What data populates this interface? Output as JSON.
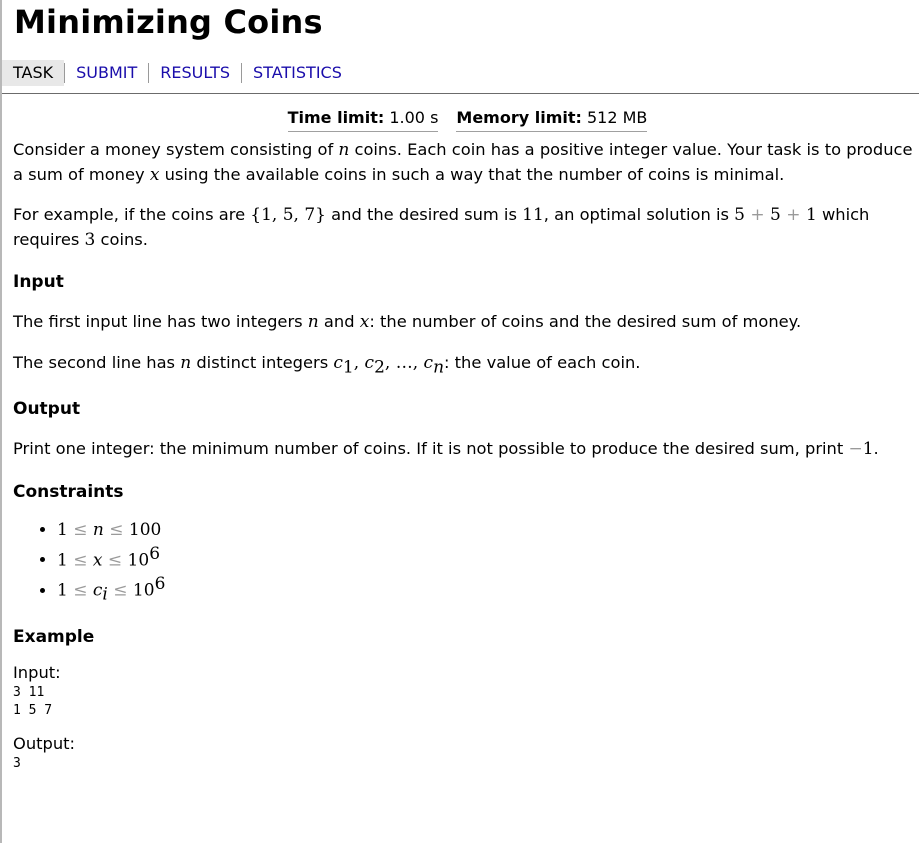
{
  "page_title": "Minimizing Coins",
  "nav": {
    "tabs": [
      {
        "label": "TASK",
        "current": true
      },
      {
        "label": "SUBMIT"
      },
      {
        "label": "RESULTS"
      },
      {
        "label": "STATISTICS"
      }
    ]
  },
  "limits": {
    "time_label": "Time limit:",
    "time_value": "1.00 s",
    "memory_label": "Memory limit:",
    "memory_value": "512 MB"
  },
  "statement": {
    "p1_a": "Consider a money system consisting of ",
    "p1_n": "n",
    "p1_b": " coins. Each coin has a positive integer value. Your task is to produce a sum of money ",
    "p1_x": "x",
    "p1_c": " using the available coins in such a way that the number of coins is minimal.",
    "p2_a": "For example, if the coins are ",
    "p2_set": "{1, 5, 7}",
    "p2_b": " and the desired sum is ",
    "p2_sum": "11",
    "p2_c": ", an optimal solution is ",
    "p2_expr_1": "5",
    "p2_expr_plus1": " + ",
    "p2_expr_2": "5",
    "p2_expr_plus2": " + ",
    "p2_expr_3": "1",
    "p2_d": " which requires ",
    "p2_count": "3",
    "p2_e": " coins."
  },
  "input_section": {
    "heading": "Input",
    "l1_a": "The first input line has two integers ",
    "l1_n": "n",
    "l1_and": " and ",
    "l1_x": "x",
    "l1_b": ": the number of coins and the desired sum of money.",
    "l2_a": "The second line has ",
    "l2_n": "n",
    "l2_b": " distinct integers ",
    "l2_c": "c",
    "l2_s1": "1",
    "l2_c2": "c",
    "l2_s2": "2",
    "l2_dots": "…",
    "l2_cn": "c",
    "l2_sn": "n",
    "l2_tail": ": the value of each coin."
  },
  "output_section": {
    "heading": "Output",
    "text_a": "Print one integer: the minimum number of coins. If it is not possible to produce the desired sum, print ",
    "minus": "−",
    "one": "1",
    "text_end": "."
  },
  "constraints": {
    "heading": "Constraints",
    "items": [
      {
        "low": "1",
        "var": "n",
        "high": "100",
        "exp": ""
      },
      {
        "low": "1",
        "var": "x",
        "high": "10",
        "exp": "6"
      },
      {
        "low": "1",
        "var": "c",
        "sub": "i",
        "high": "10",
        "exp": "6"
      }
    ]
  },
  "example": {
    "heading": "Example",
    "input_label": "Input:",
    "input_text": "3 11\n1 5 7",
    "output_label": "Output:",
    "output_text": "3"
  }
}
